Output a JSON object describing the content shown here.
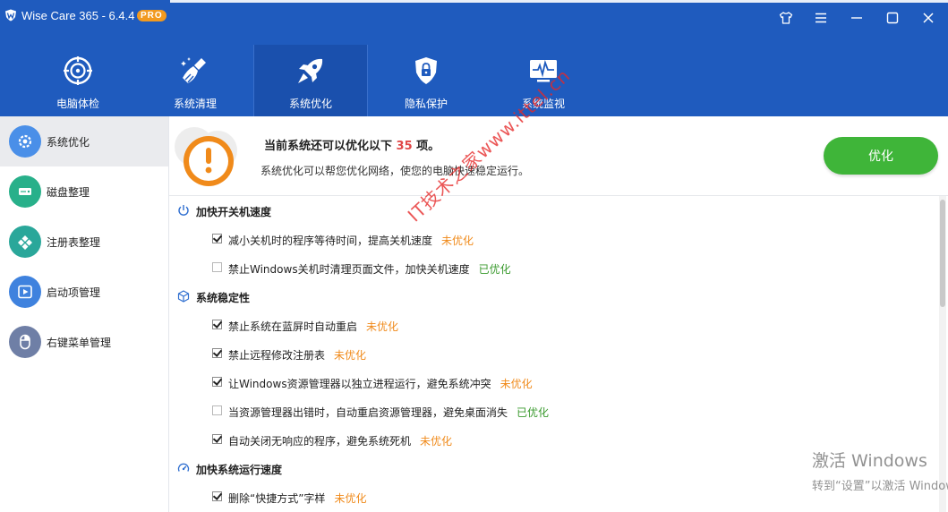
{
  "app": {
    "title": "Wise Care 365 - 6.4.4",
    "badge": "PRO"
  },
  "window_controls": [
    "skin-icon",
    "menu-icon",
    "minimize-icon",
    "maximize-icon",
    "close-icon"
  ],
  "nav": {
    "tabs": [
      {
        "label": "电脑体检",
        "icon": "target-icon",
        "active": false
      },
      {
        "label": "系统清理",
        "icon": "broom-icon",
        "active": false
      },
      {
        "label": "系统优化",
        "icon": "rocket-icon",
        "active": true
      },
      {
        "label": "隐私保护",
        "icon": "lock-shield-icon",
        "active": false
      },
      {
        "label": "系统监视",
        "icon": "monitor-pulse-icon",
        "active": false
      }
    ]
  },
  "sidebar": {
    "items": [
      {
        "label": "系统优化",
        "icon": "gear-icon",
        "color": "#4a8fe8",
        "active": true
      },
      {
        "label": "磁盘整理",
        "icon": "disk-icon",
        "color": "#28b08a",
        "active": false
      },
      {
        "label": "注册表整理",
        "icon": "registry-icon",
        "color": "#2aa79a",
        "active": false
      },
      {
        "label": "启动项管理",
        "icon": "play-icon",
        "color": "#3f82de",
        "active": false
      },
      {
        "label": "右键菜单管理",
        "icon": "mouse-icon",
        "color": "#6f7fa6",
        "active": false
      }
    ]
  },
  "summary": {
    "title_prefix": "当前系统还可以优化以下",
    "count": "35",
    "title_suffix": "项。",
    "subtitle": "系统优化可以帮您优化网络，使您的电脑快速稳定运行。",
    "button_label": "优化"
  },
  "sections": [
    {
      "title": "加快开关机速度",
      "icon": "power-icon",
      "items": [
        {
          "label": "减小关机时的程序等待时间，提高关机速度",
          "checked": true,
          "status": "未优化"
        },
        {
          "label": "禁止Windows关机时清理页面文件，加快关机速度",
          "checked": false,
          "status": "已优化"
        }
      ]
    },
    {
      "title": "系统稳定性",
      "icon": "cube-icon",
      "items": [
        {
          "label": "禁止系统在蓝屏时自动重启",
          "checked": true,
          "status": "未优化"
        },
        {
          "label": "禁止远程修改注册表",
          "checked": true,
          "status": "未优化"
        },
        {
          "label": "让Windows资源管理器以独立进程运行，避免系统冲突",
          "checked": true,
          "status": "未优化"
        },
        {
          "label": "当资源管理器出错时，自动重启资源管理器，避免桌面消失",
          "checked": false,
          "status": "已优化"
        },
        {
          "label": "自动关闭无响应的程序，避免系统死机",
          "checked": true,
          "status": "未优化"
        }
      ]
    },
    {
      "title": "加快系统运行速度",
      "icon": "speed-icon",
      "items": [
        {
          "label": "删除“快捷方式”字样",
          "checked": true,
          "status": "未优化"
        }
      ]
    }
  ],
  "colors": {
    "header": "#1f5bbe",
    "accent_green": "#3fb539",
    "pending": "#f08a1a",
    "done": "#3a9a2e",
    "count_red": "#e04848"
  },
  "watermark": "IT技术之家www.ittel.cn",
  "activation": {
    "line1": "激活 Windows",
    "line2": "转到“设置”以激活 Windows。"
  }
}
